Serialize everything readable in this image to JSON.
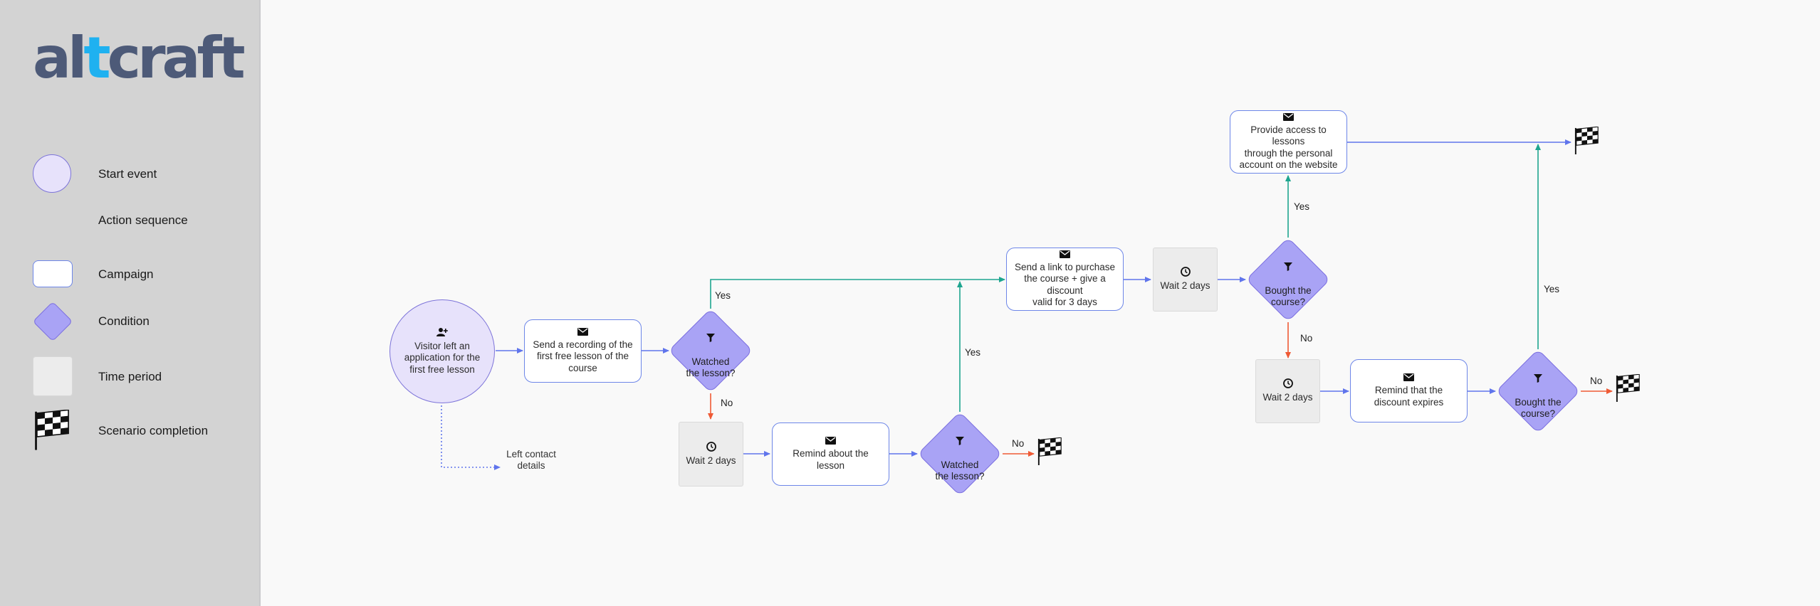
{
  "brand": {
    "logo_prefix": "al",
    "logo_t": "t",
    "logo_suffix": "craft",
    "accent_color": "#1fb1f0",
    "text_color": "#4d5a78"
  },
  "legend": {
    "start_event": "Start event",
    "action_sequence": "Action sequence",
    "campaign": "Campaign",
    "condition": "Condition",
    "time_period": "Time period",
    "scenario_completion": "Scenario completion"
  },
  "colors": {
    "blue_arrow": "#6075ec",
    "green_arrow": "#1ea58f",
    "red_arrow": "#ef5a35",
    "condition_fill": "#a9a3f5",
    "start_fill": "#e7e2fb"
  },
  "nodes": {
    "start": "Visitor left an\napplication for the\nfirst free lesson",
    "send_recording": "Send a recording of the\nfirst free lesson of the\ncourse",
    "cond1": "Watched\nthe lesson?",
    "wait1": "Wait 2 days",
    "remind_lesson": "Remind about the\nlesson",
    "cond2": "Watched\nthe lesson?",
    "send_link": "Send a link to purchase\nthe course + give a discount\nvalid for 3 days",
    "wait2": "Wait 2 days",
    "cond3": "Bought the\ncourse?",
    "provide_access": "Provide access to lessons\nthrough the personal\naccount on the website",
    "wait3": "Wait 2 days",
    "remind_discount": "Remind that the\ndiscount expires",
    "cond4": "Bought the\ncourse?",
    "left_contact": "Left contact\ndetails"
  },
  "edge_labels": {
    "cond1_yes": "Yes",
    "cond1_no": "No",
    "cond2_yes": "Yes",
    "cond2_no": "No",
    "cond3_yes": "Yes",
    "cond3_no": "No",
    "cond4_yes": "Yes",
    "cond4_no": "No"
  },
  "icons": {
    "start": "user-plus-icon",
    "campaign": "envelope-icon",
    "condition": "filter-icon",
    "time": "clock-icon",
    "end": "checkered-flag-icon"
  }
}
